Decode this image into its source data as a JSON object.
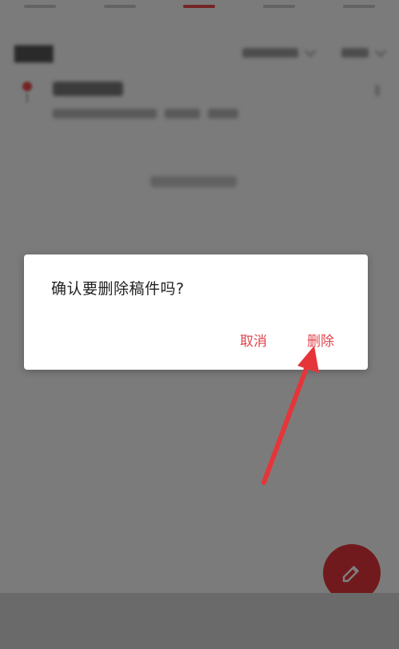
{
  "dialog": {
    "message": "确认要删除稿件吗?",
    "cancel_label": "取消",
    "delete_label": "删除"
  },
  "colors": {
    "accent": "#e0454c",
    "fab": "#e2343b",
    "annotation_arrow": "#e5353a"
  },
  "icons": {
    "fab": "edit-icon"
  }
}
